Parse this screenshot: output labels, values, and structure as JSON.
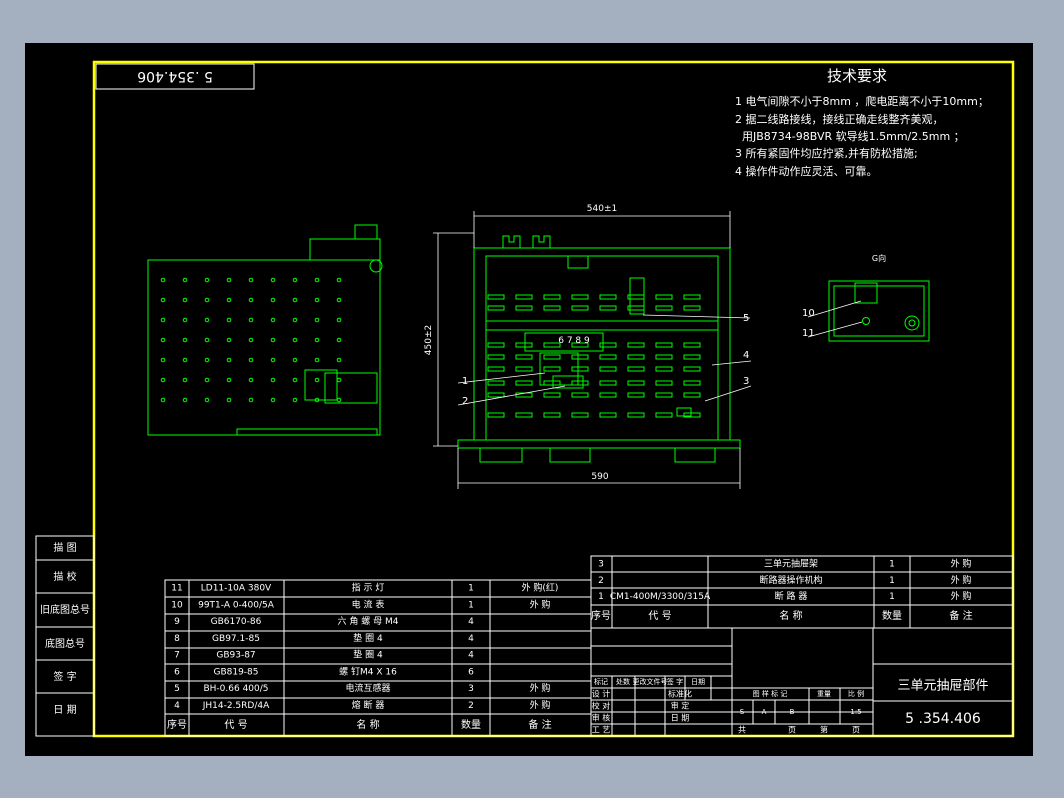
{
  "drawing_number": "5 .354.406",
  "drawing_number_rotated": "5 .354.406",
  "tech": {
    "title": "技术要求",
    "lines": [
      "1 电气间隙不小于8mm ，爬电距离不小于10mm；",
      "2 据二线路接线，接线正确走线整齐美观，",
      "  用JB8734-98BVR 软导线1.5mm/2.5mm ；",
      "3 所有紧固件均应拧紧,并有防松措施;",
      "4 操作件动作应灵活、可靠。"
    ]
  },
  "view": {
    "width_dim": "540±1",
    "height_dim": "450±2",
    "base_dim": "590",
    "detail_label": "G向",
    "terminal_label": "6 7 8 9",
    "callouts": [
      "1",
      "2",
      "3",
      "4",
      "5",
      "10",
      "11"
    ]
  },
  "left_stamps": [
    "描 图",
    "描 校",
    "旧底图总号",
    "底图总号",
    "签 字",
    "日 期"
  ],
  "bom_left": {
    "header": [
      "序号",
      "代 号",
      "名 称",
      "数量",
      "备 注"
    ],
    "rows": [
      [
        "11",
        "LD11-10A 380V",
        "指 示 灯",
        "1",
        "外 购(红)"
      ],
      [
        "10",
        "99T1-A 0-400/5A",
        "电 流 表",
        "1",
        "外 购"
      ],
      [
        "9",
        "GB6170-86",
        "六 角 螺 母 M4",
        "4",
        ""
      ],
      [
        "8",
        "GB97.1-85",
        "垫 圈 4",
        "4",
        ""
      ],
      [
        "7",
        "GB93-87",
        "垫 圈 4",
        "4",
        ""
      ],
      [
        "6",
        "GB819-85",
        "螺 钉M4 X 16",
        "6",
        ""
      ],
      [
        "5",
        "BH-0.66 400/5",
        "电流互感器",
        "3",
        "外 购"
      ],
      [
        "4",
        "JH14-2.5RD/4A",
        "熔 断 器",
        "2",
        "外 购"
      ]
    ]
  },
  "bom_right": {
    "header": [
      "序号",
      "代 号",
      "名 称",
      "数量",
      "备 注"
    ],
    "rows": [
      [
        "3",
        "",
        "三单元抽屉架",
        "1",
        "外 购"
      ],
      [
        "2",
        "",
        "断路器操作机构",
        "1",
        "外 购"
      ],
      [
        "1",
        "CM1-400M/3300/315A",
        "断 路 器",
        "1",
        "外 购"
      ]
    ]
  },
  "title_block": {
    "name": "三单元抽屉部件",
    "number": "5 .354.406",
    "rev_row": [
      "标记",
      "处数",
      "更改文件号",
      "签 字",
      "日期"
    ],
    "roles": [
      "设 计",
      "校 对",
      "审 核",
      "工 艺"
    ],
    "mid_labels": [
      "标准化",
      "审 定",
      "日 期"
    ],
    "stage_headers": [
      "图 样 标 记",
      "重量",
      "比 例"
    ],
    "stage_values": [
      "S",
      "A",
      "B",
      "1:5"
    ],
    "sheet_row": [
      "共",
      "页",
      "第",
      "页"
    ]
  },
  "colors": {
    "frame": "#ffff00",
    "lines": "#ffffff",
    "geometry": "#00ff00",
    "background": "#000000"
  }
}
